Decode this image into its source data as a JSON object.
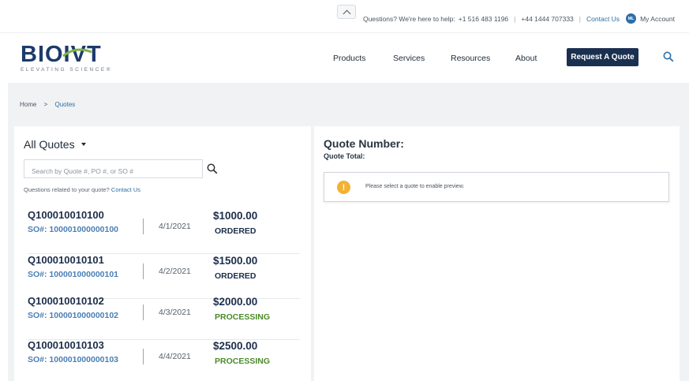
{
  "utility_bar": {
    "help_text": "Questions? We're here to help:",
    "phone_us": "+1 516 483 1196",
    "phone_uk": "+44 1444 707333",
    "contact_label": "Contact Us",
    "account_initials": "ML",
    "account_label": "My Account"
  },
  "brand": {
    "logo_text": "BIOIVT",
    "tagline": "ELEVATING SCIENCE®"
  },
  "nav": {
    "items": [
      "Products",
      "Services",
      "Resources",
      "About"
    ],
    "cta_label": "Request A Quote"
  },
  "breadcrumb": {
    "home": "Home",
    "separator": ">",
    "current": "Quotes"
  },
  "quotes_panel": {
    "title": "All Quotes",
    "search_placeholder": "Search by Quote #, PO #, or SO #",
    "help_prefix": "Questions related to your quote?",
    "help_link": "Contact Us",
    "quotes": [
      {
        "id": "Q100010010100",
        "so": "SO#: 100001000000100",
        "date": "4/1/2021",
        "amount": "$1000.00",
        "status": "ORDERED"
      },
      {
        "id": "Q100010010101",
        "so": "SO#: 100001000000101",
        "date": "4/2/2021",
        "amount": "$1500.00",
        "status": "ORDERED"
      },
      {
        "id": "Q100010010102",
        "so": "SO#: 100001000000102",
        "date": "4/3/2021",
        "amount": "$2000.00",
        "status": "PROCESSING"
      },
      {
        "id": "Q100010010103",
        "so": "SO#: 100001000000103",
        "date": "4/4/2021",
        "amount": "$2500.00",
        "status": "PROCESSING"
      }
    ]
  },
  "preview_panel": {
    "quote_number_label": "Quote Number:",
    "quote_total_label": "Quote Total:",
    "notice_icon": "!",
    "notice_text": "Please select a quote to enable preview."
  },
  "colors": {
    "brand_navy": "#1b3050",
    "link_blue": "#2f6ea6",
    "status_processing": "#4b8a2a",
    "warning": "#f2b233"
  }
}
